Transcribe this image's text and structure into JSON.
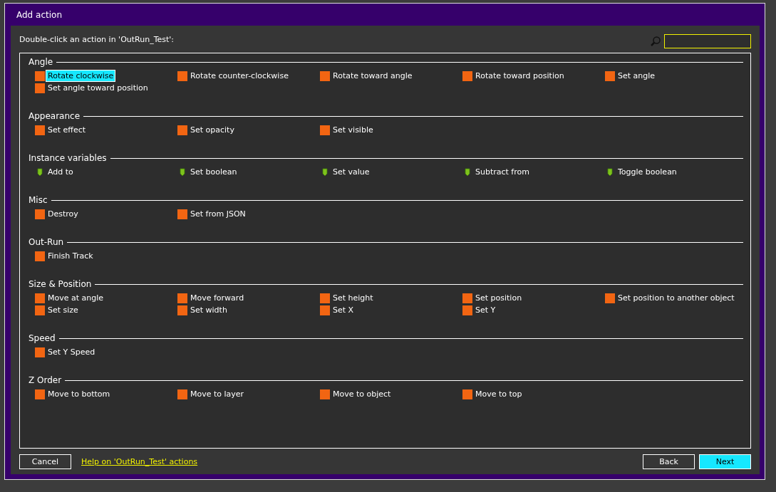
{
  "window": {
    "title": "Add action"
  },
  "prompt": "Double-click an action in 'OutRun_Test':",
  "groups": [
    {
      "title": "Angle",
      "items": [
        {
          "label": "Rotate clockwise",
          "kind": "action",
          "selected": true
        },
        {
          "label": "Rotate counter-clockwise",
          "kind": "action",
          "selected": false
        },
        {
          "label": "Rotate toward angle",
          "kind": "action",
          "selected": false
        },
        {
          "label": "Rotate toward position",
          "kind": "action",
          "selected": false
        },
        {
          "label": "Set angle",
          "kind": "action",
          "selected": false
        },
        {
          "label": "Set angle toward position",
          "kind": "action",
          "selected": false
        }
      ]
    },
    {
      "title": "Appearance",
      "items": [
        {
          "label": "Set effect",
          "kind": "action",
          "selected": false
        },
        {
          "label": "Set opacity",
          "kind": "action",
          "selected": false
        },
        {
          "label": "Set visible",
          "kind": "action",
          "selected": false
        }
      ]
    },
    {
      "title": "Instance variables",
      "items": [
        {
          "label": "Add to",
          "kind": "variable",
          "selected": false
        },
        {
          "label": "Set boolean",
          "kind": "variable",
          "selected": false
        },
        {
          "label": "Set value",
          "kind": "variable",
          "selected": false
        },
        {
          "label": "Subtract from",
          "kind": "variable",
          "selected": false
        },
        {
          "label": "Toggle boolean",
          "kind": "variable",
          "selected": false
        }
      ]
    },
    {
      "title": "Misc",
      "items": [
        {
          "label": "Destroy",
          "kind": "action",
          "selected": false
        },
        {
          "label": "Set from JSON",
          "kind": "action",
          "selected": false
        }
      ]
    },
    {
      "title": "Out-Run",
      "items": [
        {
          "label": "Finish Track",
          "kind": "action",
          "selected": false
        }
      ]
    },
    {
      "title": "Size & Position",
      "items": [
        {
          "label": "Move at angle",
          "kind": "action",
          "selected": false
        },
        {
          "label": "Move forward",
          "kind": "action",
          "selected": false
        },
        {
          "label": "Set height",
          "kind": "action",
          "selected": false
        },
        {
          "label": "Set position",
          "kind": "action",
          "selected": false
        },
        {
          "label": "Set position to another object",
          "kind": "action",
          "selected": false
        },
        {
          "label": "Set size",
          "kind": "action",
          "selected": false
        },
        {
          "label": "Set width",
          "kind": "action",
          "selected": false
        },
        {
          "label": "Set X",
          "kind": "action",
          "selected": false
        },
        {
          "label": "Set Y",
          "kind": "action",
          "selected": false
        }
      ]
    },
    {
      "title": "Speed",
      "items": [
        {
          "label": "Set Y Speed",
          "kind": "action",
          "selected": false
        }
      ]
    },
    {
      "title": "Z Order",
      "items": [
        {
          "label": "Move to bottom",
          "kind": "action",
          "selected": false
        },
        {
          "label": "Move to layer",
          "kind": "action",
          "selected": false
        },
        {
          "label": "Move to object",
          "kind": "action",
          "selected": false
        },
        {
          "label": "Move to top",
          "kind": "action",
          "selected": false
        }
      ]
    }
  ],
  "footer": {
    "cancel": "Cancel",
    "help_link": "Help on 'OutRun_Test' actions",
    "back": "Back",
    "next": "Next"
  }
}
